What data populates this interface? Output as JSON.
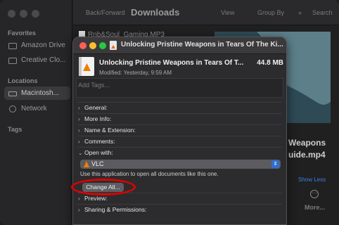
{
  "finder": {
    "nav_label": "Back/Forward",
    "title": "Downloads",
    "view_label": "View",
    "group_label": "Group By",
    "search_label": "Search",
    "sidebar": {
      "favorites_heading": "Favorites",
      "favorites": [
        "Amazon Drive",
        "Creative Clo..."
      ],
      "locations_heading": "Locations",
      "locations": [
        "Macintosh...",
        "Network"
      ],
      "tags_heading": "Tags"
    },
    "list_first_row": "Rnb&Soul_Gaming.MP3",
    "list_last_row": "...",
    "right_title": "Weapons",
    "right_sub": "uide.mp4",
    "show_less": "Show Less",
    "more_label": "More..."
  },
  "info": {
    "window_title": "Unlocking Pristine Weapons in Tears Of The Ki...",
    "file_name": "Unlocking Pristine Weapons in Tears Of T...",
    "file_size": "44.8 MB",
    "modified": "Modified: Yesterday, 9:59 AM",
    "tags_placeholder": "Add Tags...",
    "sections": {
      "general": "General:",
      "more_info": "More Info:",
      "name_ext": "Name & Extension:",
      "comments": "Comments:",
      "open_with": "Open with:",
      "preview": "Preview:",
      "sharing": "Sharing & Permissions:"
    },
    "app_selected": "VLC",
    "use_text": "Use this application to open all documents like this one.",
    "change_all": "Change All..."
  },
  "colors": {
    "highlight": "#e00000",
    "accent": "#2f6fd6",
    "vlc": "#ef7d00"
  }
}
